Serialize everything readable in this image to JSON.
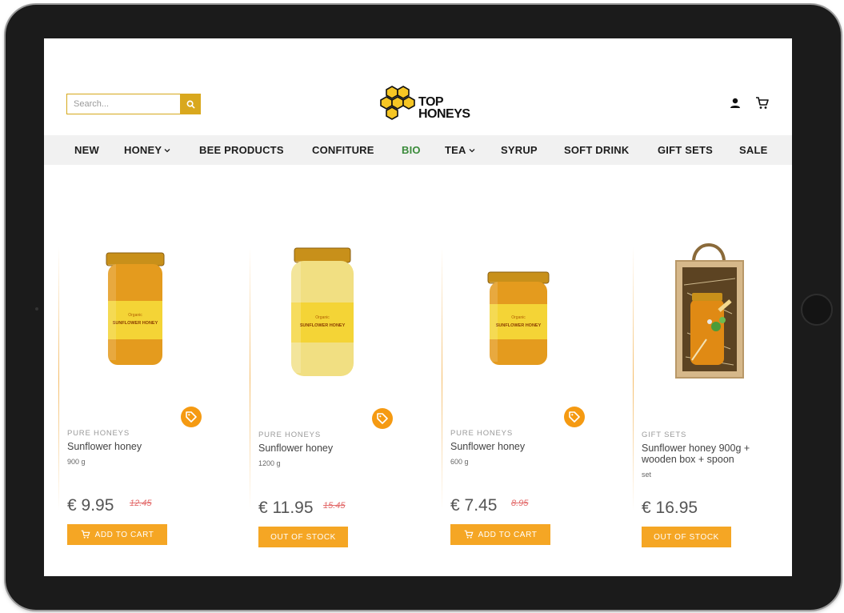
{
  "search": {
    "placeholder": "Search..."
  },
  "logo": {
    "line1": "TOP",
    "line2": "HONEYS"
  },
  "nav": [
    {
      "label": "NEW"
    },
    {
      "label": "HONEY",
      "dropdown": true
    },
    {
      "label": "BEE PRODUCTS"
    },
    {
      "label": "CONFITURE"
    },
    {
      "label": "BIO",
      "active": true
    },
    {
      "label": "TEA",
      "dropdown": true
    },
    {
      "label": "SYRUP"
    },
    {
      "label": "SOFT DRINK"
    },
    {
      "label": "GIFT SETS"
    },
    {
      "label": "SALE"
    }
  ],
  "products": [
    {
      "category": "PURE HONEYS",
      "name": "Sunflower honey",
      "unit": "900 g",
      "price": "€ 9.95",
      "old_price": "12.45",
      "button": "ADD TO CART",
      "sale_badge": true
    },
    {
      "category": "PURE HONEYS",
      "name": "Sunflower honey",
      "unit": "1200 g",
      "price": "€ 11.95",
      "old_price": "15.45",
      "button": "OUT OF STOCK",
      "sale_badge": true
    },
    {
      "category": "PURE HONEYS",
      "name": "Sunflower honey",
      "unit": "600 g",
      "price": "€ 7.45",
      "old_price": "8.95",
      "button": "ADD TO CART",
      "sale_badge": true
    },
    {
      "category": "GIFT SETS",
      "name_line1": "Sunflower honey 900g +",
      "name_line2": "wooden box + spoon",
      "unit": "set",
      "price": "€ 16.95",
      "button": "OUT OF STOCK"
    }
  ],
  "jar_label": {
    "brand": "Organic",
    "title": "SUNFLOWER HONEY"
  },
  "colors": {
    "accent": "#f5a624",
    "brand_gold": "#d9a81e",
    "bio_green": "#3a8b3a",
    "old_price": "#e36b6b"
  }
}
